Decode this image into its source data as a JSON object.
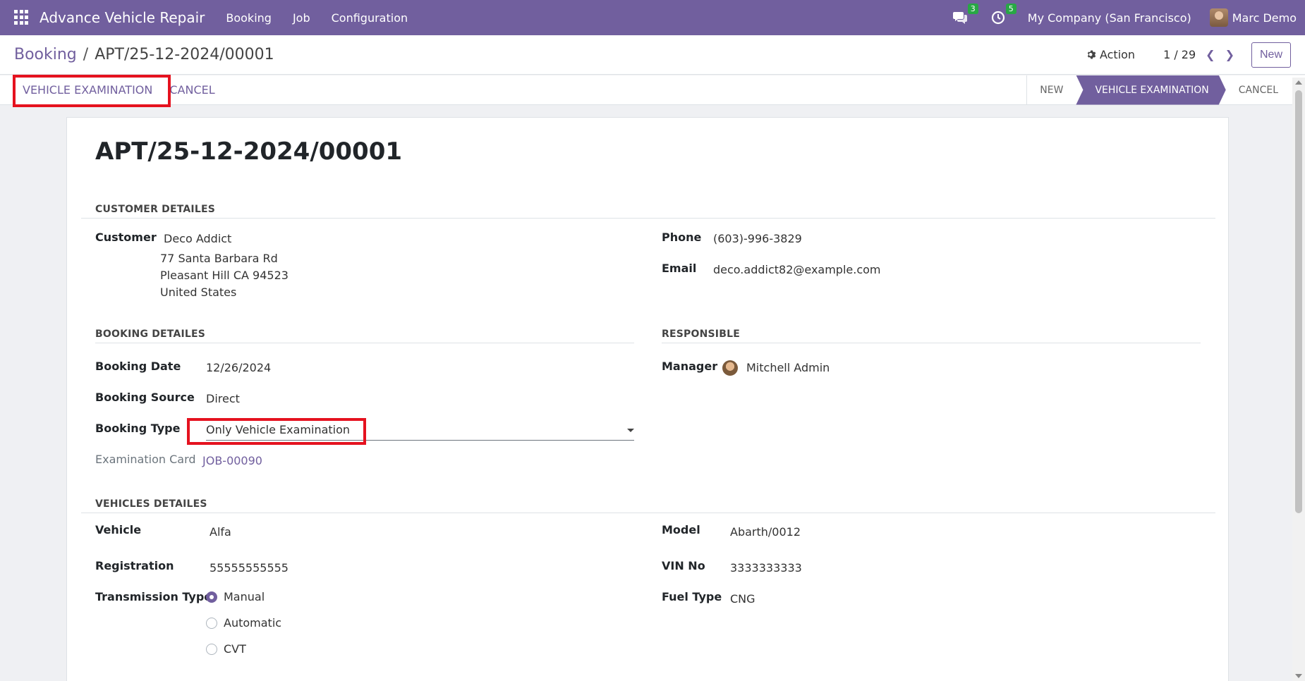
{
  "navbar": {
    "app_name": "Advance Vehicle Repair",
    "menus": [
      "Booking",
      "Job",
      "Configuration"
    ],
    "messages_count": "3",
    "activities_count": "5",
    "company": "My Company (San Francisco)",
    "user": "Marc Demo"
  },
  "control": {
    "breadcrumb_parent": "Booking",
    "breadcrumb_sep": "/",
    "breadcrumb_current": "APT/25-12-2024/00001",
    "action_label": "Action",
    "pager": "1 / 29",
    "new_label": "New"
  },
  "statusbar": {
    "buttons": [
      "VEHICLE EXAMINATION",
      "CANCEL"
    ],
    "stages": [
      "NEW",
      "VEHICLE EXAMINATION",
      "CANCEL"
    ],
    "active_stage": "VEHICLE EXAMINATION"
  },
  "record": {
    "title": "APT/25-12-2024/00001",
    "customer_section": "CUSTOMER DETAILES",
    "customer_label": "Customer",
    "customer_name": "Deco Addict",
    "address_line1": "77 Santa Barbara Rd",
    "address_line2": "Pleasant Hill CA 94523",
    "address_line3": "United States",
    "phone_label": "Phone",
    "phone": "(603)-996-3829",
    "email_label": "Email",
    "email": "deco.addict82@example.com",
    "booking_section": "BOOKING DETAILES",
    "booking_date_label": "Booking Date",
    "booking_date": "12/26/2024",
    "booking_source_label": "Booking Source",
    "booking_source": "Direct",
    "booking_type_label": "Booking Type",
    "booking_type": "Only Vehicle Examination",
    "exam_card_label": "Examination Card",
    "exam_card": "JOB-00090",
    "responsible_section": "RESPONSIBLE",
    "manager_label": "Manager",
    "manager": "Mitchell Admin",
    "vehicles_section": "VEHICLES DETAILES",
    "vehicle_label": "Vehicle",
    "vehicle": "Alfa",
    "model_label": "Model",
    "model": "Abarth/0012",
    "registration_label": "Registration",
    "registration": "55555555555",
    "vin_label": "VIN No",
    "vin": "3333333333",
    "transmission_label": "Transmission Type",
    "transmission_options": [
      "Manual",
      "Automatic",
      "CVT"
    ],
    "transmission_selected": "Manual",
    "fuel_label": "Fuel Type",
    "fuel": "CNG"
  },
  "colors": {
    "brand": "#715f9e",
    "highlight": "#e5121f",
    "badge": "#28a745"
  }
}
